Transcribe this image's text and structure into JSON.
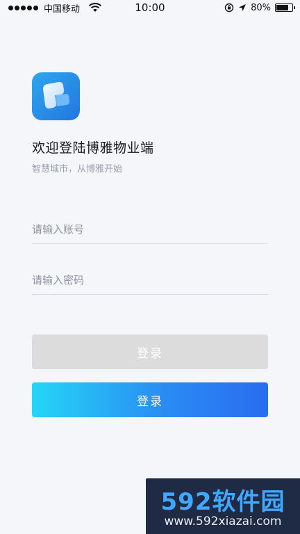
{
  "status_bar": {
    "carrier": "中国移动",
    "time": "10:00",
    "battery_percent": "80%",
    "battery_level": 0.8
  },
  "brand": {
    "title": "欢迎登陆博雅物业端",
    "subtitle": "智慧城市，从博雅开始",
    "logo_colors": [
      "#2fa6ee",
      "#2277e0"
    ]
  },
  "form": {
    "account_placeholder": "请输入账号",
    "password_placeholder": "请输入密码"
  },
  "buttons": {
    "login_disabled_label": "登录",
    "login_primary_label": "登录"
  },
  "watermark": {
    "brand": "592软件园",
    "url": "www.592xiazai.com"
  },
  "colors": {
    "accent_start": "#25d6f6",
    "accent_end": "#2a6cf0",
    "disabled": "#dcdcdc",
    "background": "#f4f6fa"
  },
  "icons": [
    "signal-icon",
    "wifi-icon",
    "orientation-lock-icon",
    "location-arrow-icon",
    "battery-icon",
    "app-logo-icon"
  ]
}
